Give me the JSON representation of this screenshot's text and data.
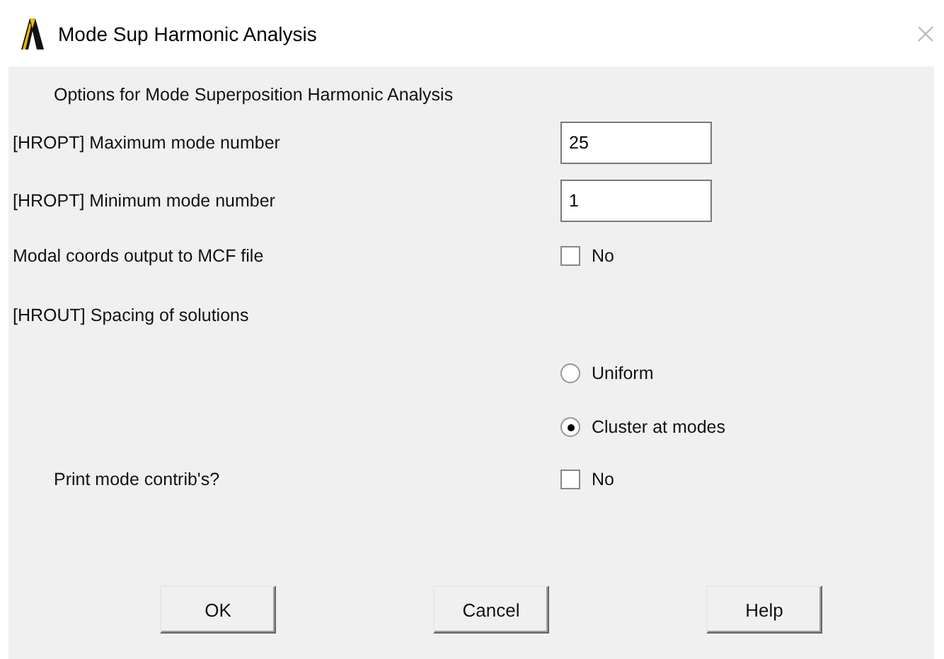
{
  "window": {
    "title": "Mode Sup Harmonic Analysis"
  },
  "rows": [
    {
      "kind": "heading",
      "label": "Options for Mode Superposition Harmonic Analysis"
    },
    {
      "kind": "text_field",
      "label": "[HROPT]  Maximum mode number",
      "value": "25"
    },
    {
      "kind": "text_field",
      "label": "[HROPT]  Minimum mode number",
      "value": "1"
    },
    {
      "kind": "checkbox",
      "label": "Modal coords output to MCF file",
      "option": "No",
      "checked": false
    },
    {
      "kind": "label",
      "label": "[HROUT]  Spacing of solutions"
    },
    {
      "kind": "radio",
      "option": "Uniform",
      "selected": false
    },
    {
      "kind": "radio",
      "option": "Cluster at modes",
      "selected": true
    },
    {
      "kind": "checkbox",
      "indent": true,
      "label": "Print mode contrib's?",
      "option": "No",
      "checked": false
    }
  ],
  "buttons": [
    "OK",
    "Cancel",
    "Help"
  ]
}
